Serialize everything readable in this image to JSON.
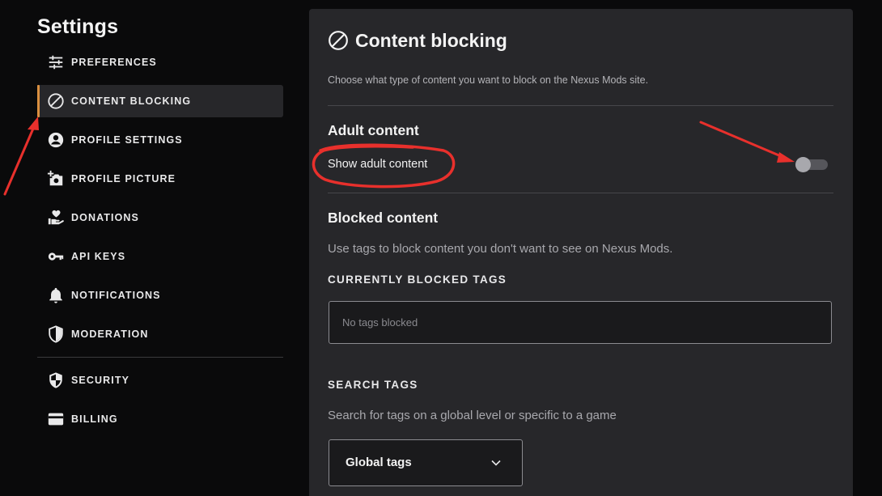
{
  "sidebar": {
    "title": "Settings",
    "items": [
      {
        "label": "PREFERENCES",
        "icon": "sliders-icon"
      },
      {
        "label": "CONTENT BLOCKING",
        "icon": "block-icon",
        "active": true
      },
      {
        "label": "PROFILE SETTINGS",
        "icon": "user-circle-icon"
      },
      {
        "label": "PROFILE PICTURE",
        "icon": "camera-add-icon"
      },
      {
        "label": "DONATIONS",
        "icon": "hand-heart-icon"
      },
      {
        "label": "API KEYS",
        "icon": "key-icon"
      },
      {
        "label": "NOTIFICATIONS",
        "icon": "bell-icon"
      },
      {
        "label": "MODERATION",
        "icon": "shield-half-icon"
      },
      {
        "label": "SECURITY",
        "icon": "shield-check-icon"
      },
      {
        "label": "BILLING",
        "icon": "card-icon"
      }
    ]
  },
  "main": {
    "title": "Content blocking",
    "description": "Choose what type of content you want to block on the Nexus Mods site.",
    "adult": {
      "heading": "Adult content",
      "toggle_label": "Show adult content",
      "toggle_on": false
    },
    "blocked": {
      "heading": "Blocked content",
      "description": "Use tags to block content you don't want to see on Nexus Mods.",
      "current_heading": "CURRENTLY BLOCKED TAGS",
      "empty_text": "No tags blocked"
    },
    "search": {
      "heading": "SEARCH TAGS",
      "description": "Search for tags on a global level or specific to a game",
      "select_value": "Global tags"
    }
  },
  "colors": {
    "accent": "#d98f40",
    "annotation": "#e8302c",
    "panel": "#27272a",
    "background": "#0a0a0b"
  }
}
